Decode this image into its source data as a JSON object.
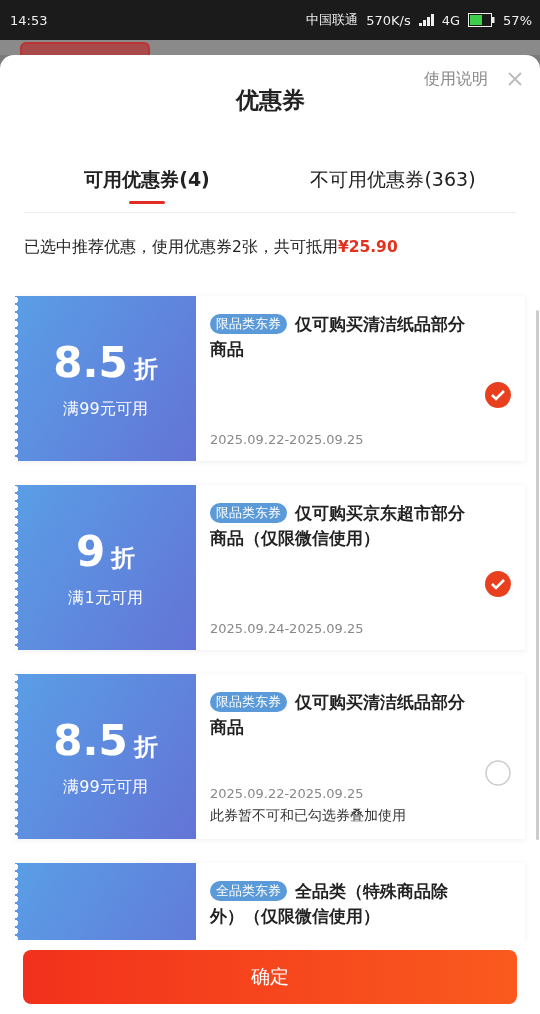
{
  "status_bar": {
    "time": "14:53",
    "carrier": "中国联通",
    "speed": "570K/s",
    "network": "4G",
    "battery": "57%"
  },
  "sheet": {
    "title": "优惠券",
    "help_link": "使用说明"
  },
  "tabs": [
    {
      "label": "可用优惠券(4)",
      "selected": true
    },
    {
      "label": "不可用优惠券(363)",
      "selected": false
    }
  ],
  "summary": {
    "text": "已选中推荐优惠，使用优惠券2张，共可抵用",
    "amount": "¥25.90"
  },
  "coupons": [
    {
      "value": "8.5",
      "unit": "折",
      "condition": "满99元可用",
      "tag": "限品类东券",
      "title": "仅可购买清洁纸品部分商品",
      "dates": "2025.09.22-2025.09.25",
      "selected": true
    },
    {
      "value": "9",
      "unit": "折",
      "condition": "满1元可用",
      "tag": "限品类东券",
      "title": "仅可购买京东超市部分商品（仅限微信使用）",
      "dates": "2025.09.24-2025.09.25",
      "selected": true
    },
    {
      "value": "8.5",
      "unit": "折",
      "condition": "满99元可用",
      "tag": "限品类东券",
      "title": "仅可购买清洁纸品部分商品",
      "dates": "2025.09.22-2025.09.25",
      "note": "此券暂不可和已勾选券叠加使用",
      "selected": false
    },
    {
      "tag": "全品类东券",
      "title": "全品类（特殊商品除外）（仅限微信使用）"
    }
  ],
  "confirm_button": "确定"
}
